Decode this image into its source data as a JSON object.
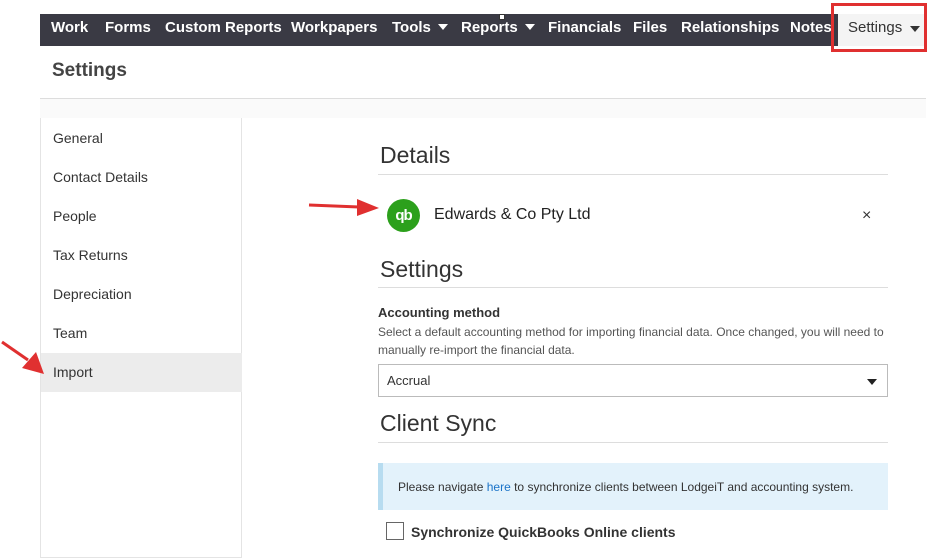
{
  "nav": {
    "items": [
      {
        "label": "Work",
        "dropdown": false
      },
      {
        "label": "Forms",
        "dropdown": false
      },
      {
        "label": "Custom Reports",
        "dropdown": false
      },
      {
        "label": "Workpapers",
        "dropdown": false
      },
      {
        "label": "Tools",
        "dropdown": true
      },
      {
        "label": "Reports",
        "dropdown": true
      },
      {
        "label": "Financials",
        "dropdown": false
      },
      {
        "label": "Files",
        "dropdown": false
      },
      {
        "label": "Relationships",
        "dropdown": false
      },
      {
        "label": "Notes",
        "dropdown": false
      }
    ],
    "settings_label": "Settings"
  },
  "page": {
    "title": "Settings"
  },
  "sidebar": {
    "items": [
      {
        "label": "General"
      },
      {
        "label": "Contact Details"
      },
      {
        "label": "People"
      },
      {
        "label": "Tax Returns"
      },
      {
        "label": "Depreciation"
      },
      {
        "label": "Team"
      },
      {
        "label": "Import"
      }
    ],
    "active": "Import"
  },
  "details": {
    "title": "Details",
    "integration_logo": "qb",
    "org_name": "Edwards & Co Pty Ltd",
    "close_symbol": "×"
  },
  "settings_section": {
    "title": "Settings",
    "accounting_label": "Accounting method",
    "accounting_help": "Select a default accounting method for importing financial data. Once changed, you will need to manually re-import the financial data.",
    "accounting_value": "Accrual"
  },
  "client_sync": {
    "title": "Client Sync",
    "info_prefix": "Please navigate ",
    "info_link": "here",
    "info_suffix": " to synchronize clients between LodgeiT and accounting system.",
    "checkbox_label": "Synchronize QuickBooks Online clients",
    "checkbox_checked": false
  },
  "colors": {
    "nav_bg": "#3a3a44",
    "accent_red": "#e03030",
    "qb_green": "#2ca01c",
    "info_bg": "#e3f2fb",
    "link": "#1a73c8"
  }
}
